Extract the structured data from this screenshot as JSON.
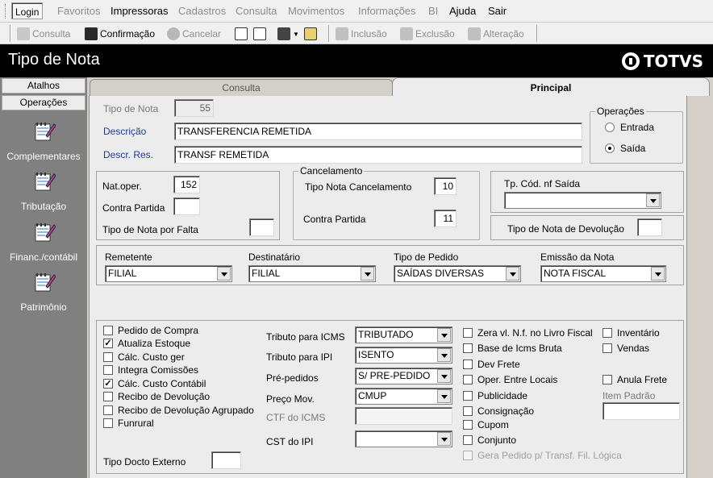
{
  "menu": [
    "Login",
    "Favoritos",
    "Impressoras",
    "Cadastros",
    "Consulta",
    "Movimentos",
    "Informações",
    "BI",
    "Ajuda",
    "Sair"
  ],
  "toolbar": {
    "consulta": "Consulta",
    "confirmacao": "Confirmação",
    "cancelar": "Cancelar",
    "inclusao": "Inclusão",
    "exclusao": "Exclusão",
    "alteracao": "Alteração"
  },
  "window": {
    "title": "Tipo de Nota",
    "logo": "TOTVS"
  },
  "sidebar": {
    "atalhos": "Atalhos",
    "operacoes": "Operações",
    "items": [
      "Complementares",
      "Tributação",
      "Financ./contábil",
      "Patrimônio"
    ]
  },
  "tabs": {
    "consulta": "Consulta",
    "principal": "Principal"
  },
  "form": {
    "tipo_nota_label": "Tipo de Nota",
    "tipo_nota": "55",
    "descricao_label": "Descrição",
    "descricao": "TRANSFERENCIA REMETIDA",
    "descr_res_label": "Descr. Res.",
    "descr_res": "TRANSF REMETIDA",
    "operacoes_title": "Operações",
    "entrada": "Entrada",
    "saida": "Saída",
    "nat_oper_label": "Nat.oper.",
    "nat_oper": "152",
    "contra_partida_label": "Contra Partida",
    "contra_partida": "",
    "tipo_falta_label": "Tipo de Nota por Falta",
    "tipo_falta": "",
    "cancelamento_title": "Cancelamento",
    "tipo_canc_label": "Tipo Nota Cancelamento",
    "tipo_canc": "10",
    "contra_partida_canc_label": "Contra Partida",
    "contra_partida_canc": "11",
    "tp_cod_label": "Tp. Cód. nf Saída",
    "tp_cod": "",
    "devolucao_label": "Tipo de Nota de Devolução",
    "devolucao": "",
    "remetente_label": "Remetente",
    "remetente": "FILIAL",
    "destinatario_label": "Destinatário",
    "destinatario": "FILIAL",
    "tipo_pedido_label": "Tipo de Pedido",
    "tipo_pedido": "SAÍDAS DIVERSAS",
    "emissao_label": "Emissão da Nota",
    "emissao": "NOTA FISCAL",
    "tributo_icms_label": "Tributo para ICMS",
    "tributo_icms": "TRIBUTADO",
    "tributo_ipi_label": "Tributo para IPI",
    "tributo_ipi": "ISENTO",
    "pre_pedidos_label": "Pré-pedidos",
    "pre_pedidos": "S/ PRE-PEDIDO",
    "preco_mov_label": "Preço Mov.",
    "preco_mov": "CMUP",
    "ctf_icms_label": "CTF do ICMS",
    "ctf_icms": "",
    "cst_ipi_label": "CST do IPI",
    "cst_ipi": "",
    "tipo_docto_label": "Tipo Docto Externo",
    "tipo_docto": "",
    "item_padrao_label": "Item Padrão",
    "item_padrao": ""
  },
  "checks_left": [
    {
      "label": "Pedido de Compra",
      "checked": false
    },
    {
      "label": "Atualiza Estoque",
      "checked": true
    },
    {
      "label": "Cálc. Custo ger",
      "checked": false
    },
    {
      "label": "Integra Comissões",
      "checked": false
    },
    {
      "label": "Cálc. Custo Contábil",
      "checked": true
    },
    {
      "label": "Recibo de Devolução",
      "checked": false
    },
    {
      "label": "Recibo de Devolução Agrupado",
      "checked": false
    },
    {
      "label": "Funrural",
      "checked": false
    }
  ],
  "checks_mid": [
    {
      "label": "Zera vl. N.f. no Livro Fiscal",
      "checked": false
    },
    {
      "label": "Base de Icms Bruta",
      "checked": false
    },
    {
      "label": "Dev Frete",
      "checked": false
    },
    {
      "label": "Oper. Entre Locais",
      "checked": false
    },
    {
      "label": "Publicidade",
      "checked": false
    },
    {
      "label": "Consignação",
      "checked": false
    },
    {
      "label": "Cupom",
      "checked": false
    },
    {
      "label": "Conjunto",
      "checked": false
    },
    {
      "label": "Gera Pedido p/ Transf. Fil. Lógica",
      "checked": false
    }
  ],
  "checks_right": [
    {
      "label": "Inventário",
      "checked": false
    },
    {
      "label": "Vendas",
      "checked": false
    },
    {
      "label": "Anula Frete",
      "checked": false
    }
  ],
  "colors": {
    "title_bg": "#000000",
    "sidebar_bg": "#808080",
    "label_blue": "#1f3c9a"
  }
}
